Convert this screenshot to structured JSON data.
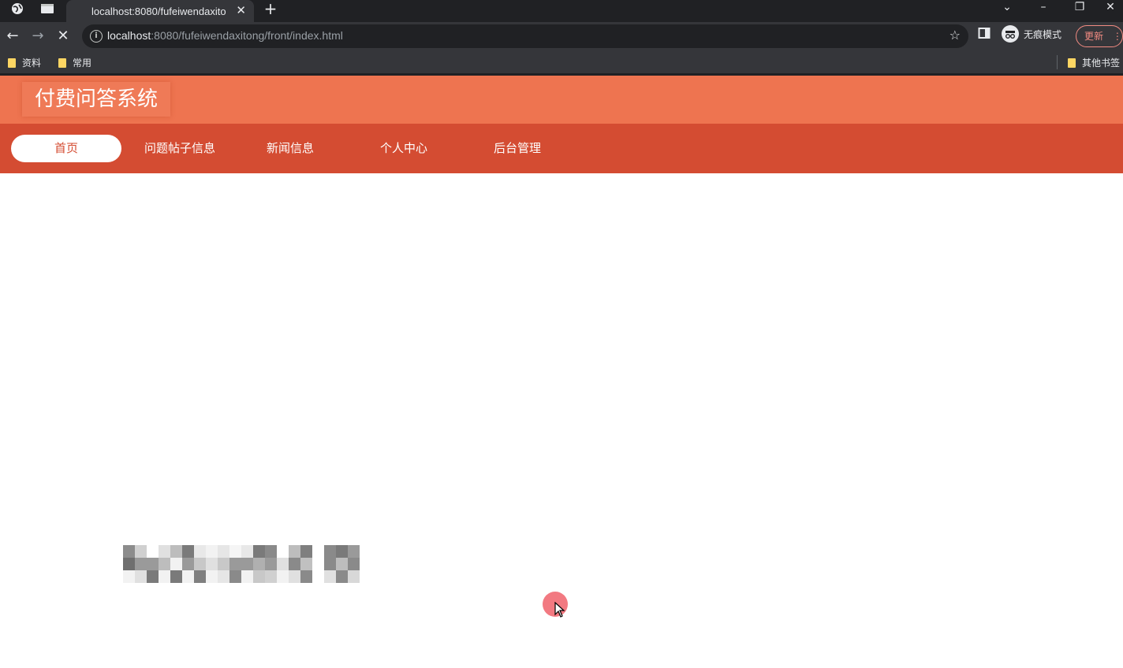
{
  "browser": {
    "tab_title": "localhost:8080/fufeiwendaxito",
    "url_host": "localhost",
    "url_rest": ":8080/fufeiwendaxitong/front/index.html",
    "incognito_label": "无痕模式",
    "update_label": "更新",
    "bookmarks": [
      {
        "label": "资料"
      },
      {
        "label": "常用"
      }
    ],
    "other_bookmarks": "其他书签"
  },
  "site": {
    "title": "付费问答系统",
    "nav": [
      {
        "label": "首页",
        "active": true
      },
      {
        "label": "问题帖子信息",
        "active": false
      },
      {
        "label": "新闻信息",
        "active": false
      },
      {
        "label": "个人中心",
        "active": false
      },
      {
        "label": "后台管理",
        "active": false
      }
    ]
  },
  "colors": {
    "header": "#ee7450",
    "nav": "#d44c32",
    "cursor_highlight": "#f0616b"
  }
}
